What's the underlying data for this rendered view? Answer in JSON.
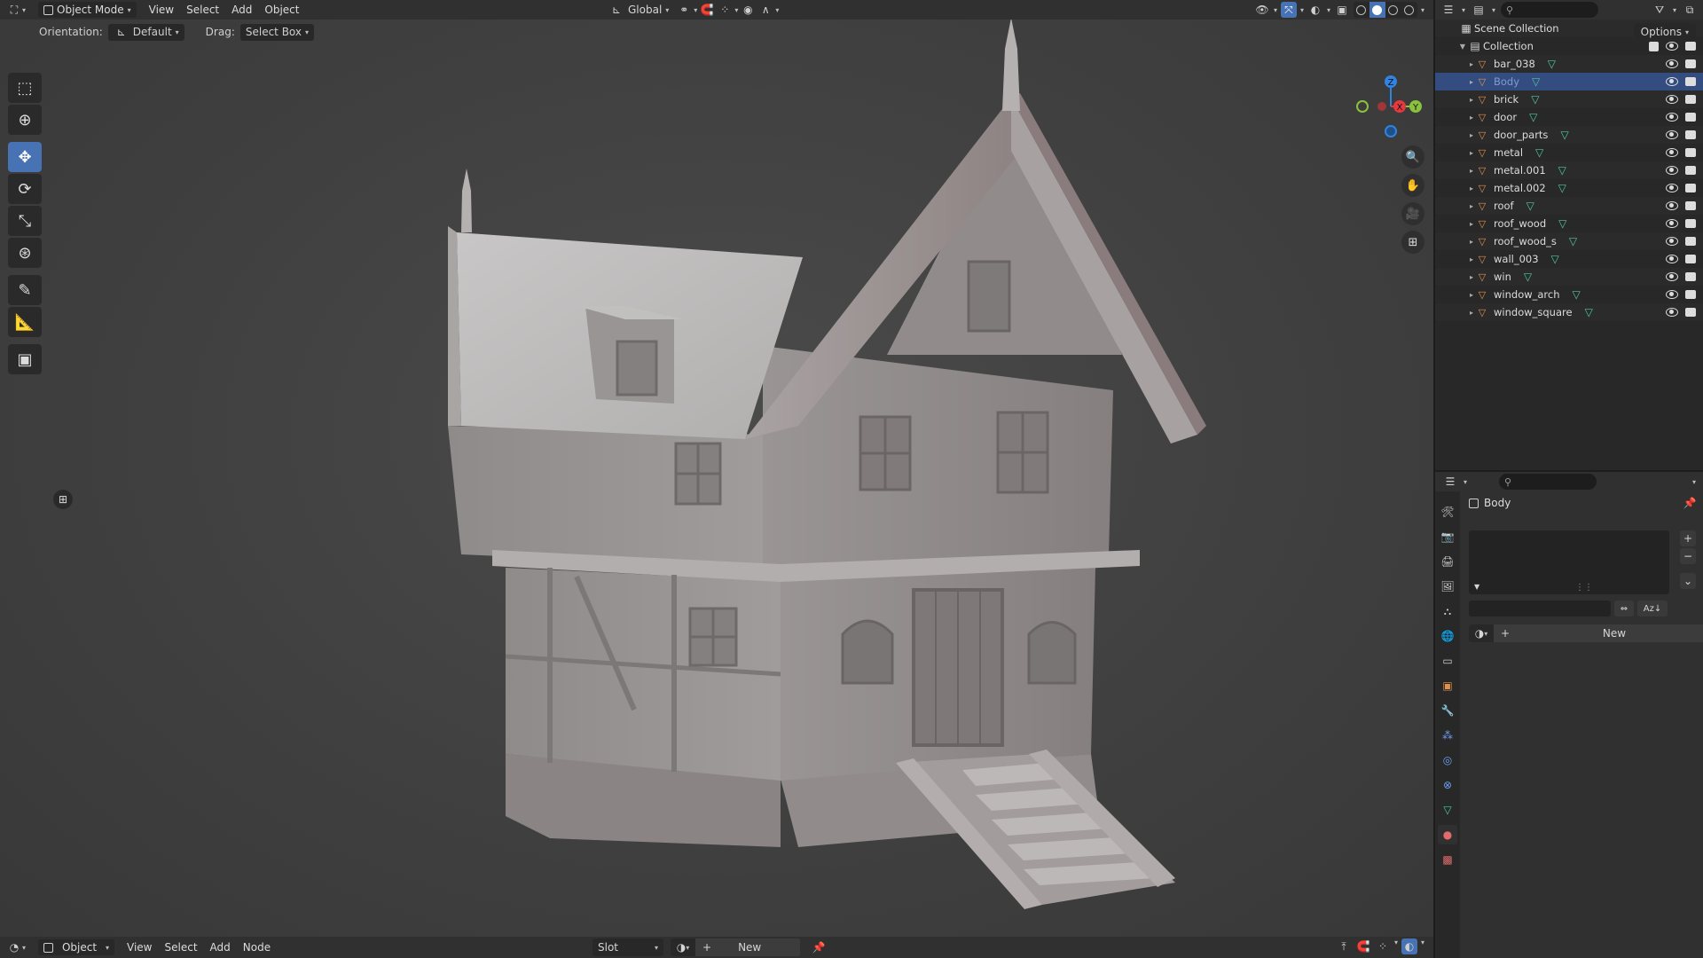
{
  "topbar": {
    "editor_icon": "3d-viewport-icon",
    "mode": "Object Mode",
    "menus": [
      "View",
      "Select",
      "Add",
      "Object"
    ],
    "transform": "Global"
  },
  "toolheader": {
    "orientation_label": "Orientation:",
    "orientation_value": "Default",
    "drag_label": "Drag:",
    "drag_value": "Select Box",
    "options_label": "Options"
  },
  "toolbar": {
    "tools": [
      "select-box",
      "cursor",
      "move",
      "rotate",
      "scale",
      "transform",
      "annotate",
      "measure",
      "add-cube"
    ],
    "active": "move"
  },
  "gizmo": {
    "axis_x": "X",
    "axis_y": "Y",
    "axis_z": "Z"
  },
  "outliner": {
    "scene_collection": "Scene Collection",
    "collection": "Collection",
    "objects": [
      {
        "name": "bar_038"
      },
      {
        "name": "Body"
      },
      {
        "name": "brick"
      },
      {
        "name": "door"
      },
      {
        "name": "door_parts"
      },
      {
        "name": "metal"
      },
      {
        "name": "metal.001"
      },
      {
        "name": "metal.002"
      },
      {
        "name": "roof"
      },
      {
        "name": "roof_wood"
      },
      {
        "name": "roof_wood_s"
      },
      {
        "name": "wall_003"
      },
      {
        "name": "win"
      },
      {
        "name": "window_arch"
      },
      {
        "name": "window_square"
      }
    ],
    "selected": "Body"
  },
  "properties": {
    "object_name": "Body",
    "new_label": "New",
    "sort_label": "Az"
  },
  "bottombar": {
    "mode": "Object",
    "menus": [
      "View",
      "Select",
      "Add",
      "Node"
    ],
    "slot_label": "Slot",
    "new_label": "New"
  },
  "colors": {
    "accent": "#4772b3",
    "selected_row": "#334d80",
    "object_icon": "#e2914a",
    "mesh_icon": "#50c7a4",
    "axis_x": "#e3393f",
    "axis_y": "#8ac23f",
    "axis_z": "#2f84e3"
  }
}
